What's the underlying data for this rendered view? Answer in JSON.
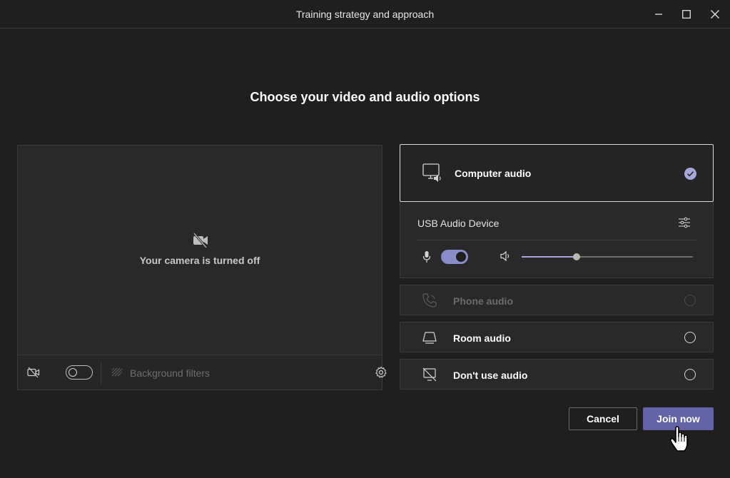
{
  "window": {
    "title": "Training strategy and approach",
    "controls": [
      "minimize-icon",
      "maximize-icon",
      "close-icon"
    ]
  },
  "heading": "Choose your video and audio options",
  "preview": {
    "camera_message": "Your camera is turned off",
    "background_filters_label": "Background filters",
    "camera_toggle_on": false
  },
  "audio": {
    "options": [
      {
        "label": "Computer audio",
        "selected": true,
        "enabled": true,
        "icon": "computer-audio-icon"
      },
      {
        "label": "Phone audio",
        "selected": false,
        "enabled": false,
        "icon": "phone-icon"
      },
      {
        "label": "Room audio",
        "selected": false,
        "enabled": true,
        "icon": "room-device-icon"
      },
      {
        "label": "Don't use audio",
        "selected": false,
        "enabled": true,
        "icon": "no-audio-icon"
      }
    ],
    "device": {
      "name": "USB Audio Device",
      "mic_on": true,
      "volume_fraction": 0.32
    }
  },
  "buttons": {
    "cancel": "Cancel",
    "join": "Join now"
  },
  "colors": {
    "accent": "#6264a7",
    "accent_light": "#a6a7dc",
    "background": "#1f1f1f",
    "panel": "#292929"
  }
}
